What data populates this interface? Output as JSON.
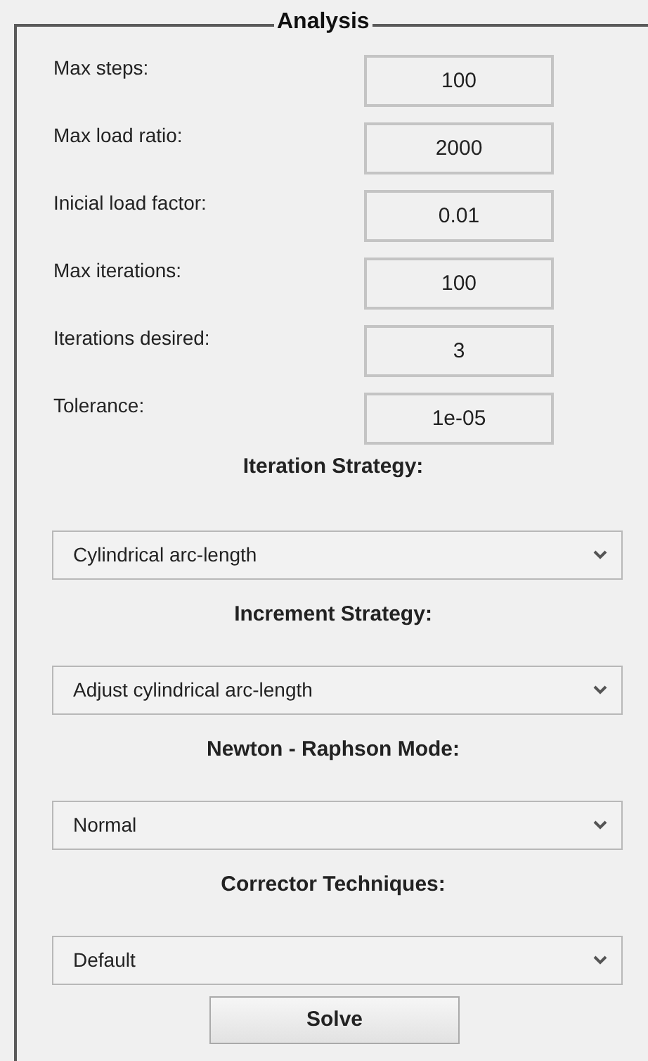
{
  "panel": {
    "title": "Analysis"
  },
  "fields": [
    {
      "label": "Max steps:",
      "value": "100"
    },
    {
      "label": "Max load ratio:",
      "value": "2000"
    },
    {
      "label": "Inicial load factor:",
      "value": "0.01"
    },
    {
      "label": "Max iterations:",
      "value": "100"
    },
    {
      "label": "Iterations desired:",
      "value": "3"
    },
    {
      "label": "Tolerance:",
      "value": "1e-05"
    }
  ],
  "dropdowns": [
    {
      "heading": "Iteration Strategy:",
      "value": "Cylindrical arc-length"
    },
    {
      "heading": "Increment Strategy:",
      "value": "Adjust cylindrical arc-length"
    },
    {
      "heading": "Newton - Raphson Mode:",
      "value": "Normal"
    },
    {
      "heading": "Corrector Techniques:",
      "value": "Default"
    }
  ],
  "buttons": [
    {
      "label": "Solve"
    }
  ]
}
